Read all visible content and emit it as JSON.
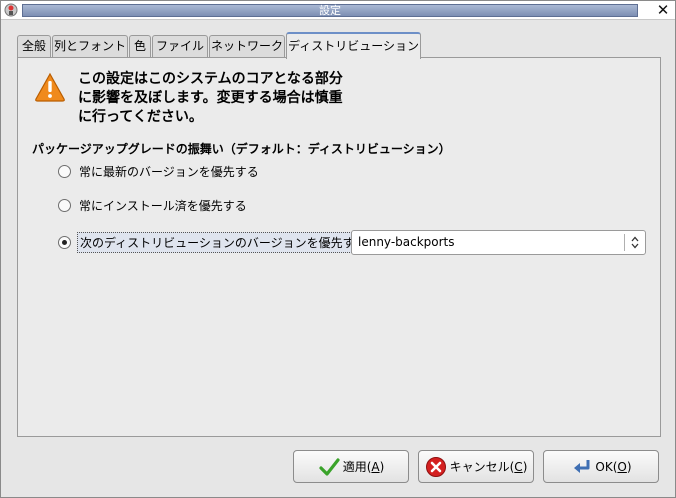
{
  "window": {
    "title": "設定"
  },
  "tabs": [
    {
      "label": "全般",
      "active": false
    },
    {
      "label": "列とフォント",
      "active": false
    },
    {
      "label": "色",
      "active": false
    },
    {
      "label": "ファイル",
      "active": false
    },
    {
      "label": "ネットワーク",
      "active": false
    },
    {
      "label": "ディストリビューション",
      "active": true
    }
  ],
  "warning": {
    "icon": "warning-icon",
    "line1": "この設定はこのシステムのコアとなる部分",
    "line2": "に影響を及ぼします。変更する場合は慎重",
    "line3": "に行ってください。"
  },
  "section_label": "パッケージアップグレードの振舞い（デフォルト：ディストリビューション）",
  "options": {
    "latest": {
      "label": "常に最新のバージョンを優先する",
      "selected": false
    },
    "installed": {
      "label": "常にインストール済を優先する",
      "selected": false
    },
    "distribution": {
      "label": "次のディストリビューションのバージョンを優先する:",
      "selected": true
    }
  },
  "distribution_combo": {
    "value": "lenny-backports"
  },
  "buttons": {
    "apply": {
      "text": "適用(",
      "mnemonic": "A",
      "close": ")",
      "icon": "checkmark-icon"
    },
    "cancel": {
      "text": "キャンセル(",
      "mnemonic": "C",
      "close": ")",
      "icon": "cancel-icon"
    },
    "ok": {
      "text": "OK(",
      "mnemonic": "O",
      "close": ")",
      "icon": "return-arrow-icon"
    }
  },
  "colors": {
    "accent": "#6d8fc7",
    "warning": "#f08a1c",
    "cancel_red": "#d42020",
    "check_green": "#3aa32a"
  }
}
